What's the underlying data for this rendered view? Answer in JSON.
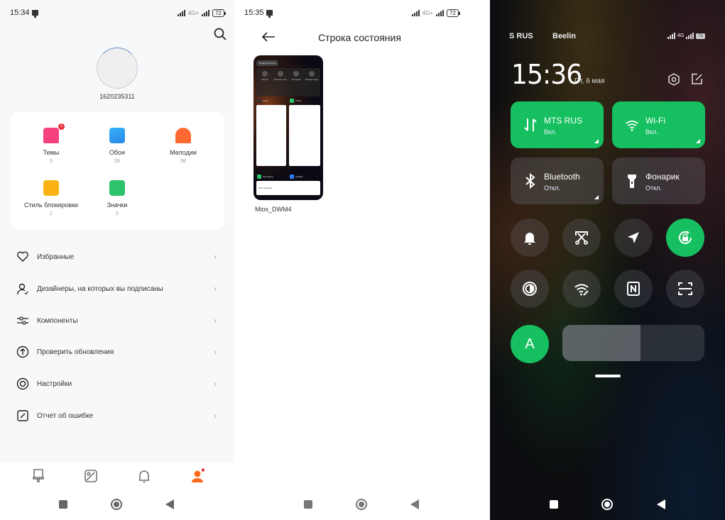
{
  "panel1": {
    "status": {
      "time": "15:34",
      "network": "4G+",
      "battery": "72"
    },
    "user_id": "1620235311",
    "categories": [
      {
        "name": "Темы",
        "count": "3",
        "icon": "themes-brush-icon",
        "color": "#f5427e",
        "badge": "1"
      },
      {
        "name": "Обои",
        "count": "26",
        "icon": "wallpaper-icon",
        "color": "#2f9bf0"
      },
      {
        "name": "Мелодии",
        "count": "58",
        "icon": "ringtone-bell-icon",
        "color": "#ff6a33"
      },
      {
        "name": "Стиль блокировки",
        "count": "2",
        "icon": "lock-style-icon",
        "color": "#fbb314"
      },
      {
        "name": "Значки",
        "count": "3",
        "icon": "icons-grid-icon",
        "color": "#2ec26a"
      }
    ],
    "menu": [
      {
        "label": "Избранные",
        "icon": "heart-icon"
      },
      {
        "label": "Дизайнеры, на которых вы подписаны",
        "icon": "user-check-icon"
      },
      {
        "label": "Компоненты",
        "icon": "sliders-icon"
      },
      {
        "label": "Проверить обновления",
        "icon": "upload-circle-icon"
      },
      {
        "label": "Настройки",
        "icon": "settings-ring-icon"
      },
      {
        "label": "Отчет об ошибке",
        "icon": "edit-square-icon"
      }
    ],
    "chevron": "›",
    "bottom_nav": [
      {
        "icon": "themes-tab-icon",
        "active": false
      },
      {
        "icon": "wallpaper-tab-icon",
        "active": false
      },
      {
        "icon": "bell-tab-icon",
        "active": false
      },
      {
        "icon": "profile-tab-icon",
        "active": true
      }
    ],
    "accent": "#ff6a1a"
  },
  "panel2": {
    "status": {
      "time": "15:35",
      "network": "4G+",
      "battery": "72"
    },
    "title": "Строка состояния",
    "item_name": "Mios_DWM4",
    "thumbnail": {
      "floating": "Floating windows",
      "tools": [
        "Cleaner",
        "Security scan",
        "Find apps",
        "Manage apps"
      ],
      "apps": [
        "Clock",
        "Phone",
        "Messaging",
        "Updater"
      ],
      "message": "New message"
    }
  },
  "panel3": {
    "carriers": [
      "S RUS",
      "Beelin"
    ],
    "network": "4G",
    "battery": "71",
    "time": "15:36",
    "date": "Пт, 6 мая",
    "tiles": [
      {
        "name": "MTS RUS",
        "state": "Вкл.",
        "on": true,
        "icon": "mobile-data-icon"
      },
      {
        "name": "Wi-Fi",
        "state": "Вкл.",
        "on": true,
        "icon": "wifi-icon"
      },
      {
        "name": "Bluetooth",
        "state": "Откл.",
        "on": false,
        "icon": "bluetooth-icon"
      },
      {
        "name": "Фонарик",
        "state": "Откл.",
        "on": false,
        "icon": "flashlight-icon"
      }
    ],
    "toggles": [
      {
        "icon": "bell-icon",
        "on": false
      },
      {
        "icon": "screenshot-scissors-icon",
        "on": false
      },
      {
        "icon": "location-icon",
        "on": false
      },
      {
        "icon": "rotation-lock-icon",
        "on": true
      },
      {
        "icon": "dark-mode-icon",
        "on": false
      },
      {
        "icon": "wifi-edit-icon",
        "on": false
      },
      {
        "icon": "nfc-icon",
        "on": false
      },
      {
        "icon": "scanner-icon",
        "on": false
      }
    ],
    "auto_brightness_label": "A",
    "brightness_percent": 55,
    "on_color": "#16c060"
  }
}
